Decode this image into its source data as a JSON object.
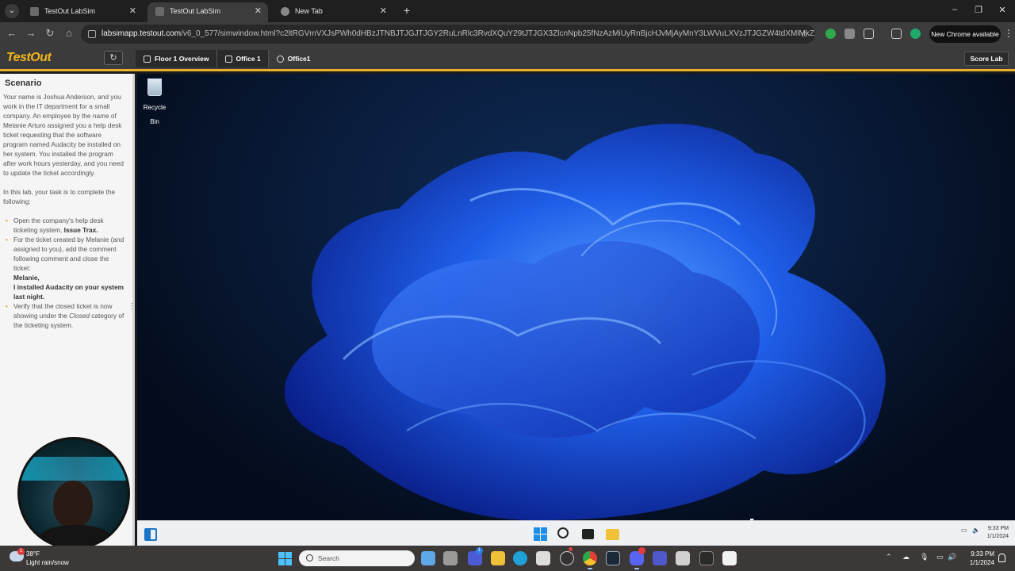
{
  "browser": {
    "tabs": [
      {
        "title": "TestOut LabSim",
        "active": false
      },
      {
        "title": "TestOut LabSim",
        "active": true
      },
      {
        "title": "New Tab",
        "active": false
      }
    ],
    "url_host": "labsimapp.testout.com",
    "url_path": "/v6_0_577/simwindow.html?c2ltRGVmVXJsPWh0dHBzJTNBJTJGJTJGY2RuLnRlc3RvdXQuY29tJTJGX3ZlcnNpb25fNzAzMiUyRnBjcHJvMjAyMnY3LWVuLXVzJTJGZW4tdXMlMkZzaW1zJTJGdHlwZ...",
    "new_chrome_label": "New Chrome available",
    "accent": "#e8b22a"
  },
  "lab": {
    "logo": "TestOut",
    "breadcrumbs": [
      "Floor 1 Overview",
      "Office 1",
      "Office1"
    ],
    "score_label": "Score Lab"
  },
  "scenario": {
    "heading": "Scenario",
    "intro": "Your name is Joshua Anderson, and you work in the IT department for a small company. An employee by the name of Melanie Arturo assigned you a help desk ticket requesting that the software program named Audacity be installed on her system. You installed the program after work hours yesterday, and you need to update the ticket accordingly.",
    "task_intro": "In this lab, your task is to complete the following:",
    "task1_text": "Open the company's help desk ticketing system, ",
    "task1_bold": "Issue Trax.",
    "task2_text": "For the ticket created by Melanie (and assigned to you), add the comment following comment and close the ticket:",
    "task2_bold1": "Melanie,",
    "task2_bold2": "I installed Audacity on your system last night.",
    "task3_pre": "Verify that the closed ticket is now showing under the ",
    "task3_em": "Closed",
    "task3_post": " category of the ticketing system."
  },
  "desktop": {
    "recycle_bin_label": "Recycle Bin",
    "vm_clock_time": "9:33 PM",
    "vm_clock_date": "1/1/2024"
  },
  "host_taskbar": {
    "temperature": "38°F",
    "weather_desc": "Light rain/snow",
    "weather_badge": "1",
    "search_placeholder": "Search",
    "clock_time": "9:33 PM",
    "clock_date": "1/1/2024",
    "teams_badge": "1"
  }
}
